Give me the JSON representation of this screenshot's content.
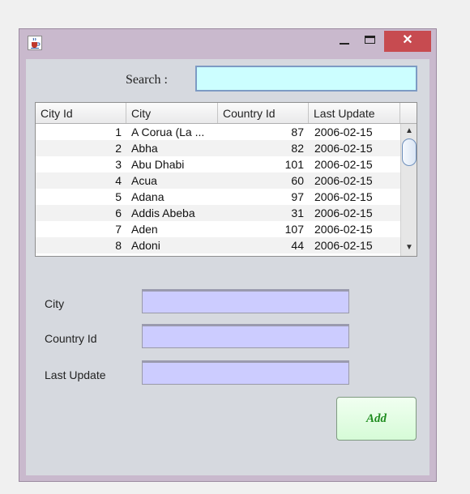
{
  "window": {
    "title": "",
    "close_glyph": "✕",
    "icons": {
      "app": "java-cup-icon",
      "minimize": "minimize-icon",
      "maximize": "maximize-icon",
      "close": "close-icon"
    }
  },
  "search": {
    "label": "Search :",
    "value": ""
  },
  "table": {
    "columns": [
      "City Id",
      "City",
      "Country Id",
      "Last Update"
    ],
    "rows": [
      {
        "city_id": "1",
        "city": "A Corua (La ...",
        "country_id": "87",
        "last_update": "2006-02-15"
      },
      {
        "city_id": "2",
        "city": "Abha",
        "country_id": "82",
        "last_update": "2006-02-15"
      },
      {
        "city_id": "3",
        "city": "Abu Dhabi",
        "country_id": "101",
        "last_update": "2006-02-15"
      },
      {
        "city_id": "4",
        "city": "Acua",
        "country_id": "60",
        "last_update": "2006-02-15"
      },
      {
        "city_id": "5",
        "city": "Adana",
        "country_id": "97",
        "last_update": "2006-02-15"
      },
      {
        "city_id": "6",
        "city": "Addis Abeba",
        "country_id": "31",
        "last_update": "2006-02-15"
      },
      {
        "city_id": "7",
        "city": "Aden",
        "country_id": "107",
        "last_update": "2006-02-15"
      },
      {
        "city_id": "8",
        "city": "Adoni",
        "country_id": "44",
        "last_update": "2006-02-15"
      }
    ],
    "scroll_up_glyph": "▲",
    "scroll_down_glyph": "▼"
  },
  "form": {
    "city_label": "City",
    "city_value": "",
    "country_label": "Country Id",
    "country_value": "",
    "update_label": "Last Update",
    "update_value": "",
    "add_label": "Add"
  },
  "colors": {
    "search_bg": "#ccfeff",
    "field_bg": "#ccccff",
    "add_text": "#1e8c1e",
    "close_bg": "#c74b50"
  }
}
